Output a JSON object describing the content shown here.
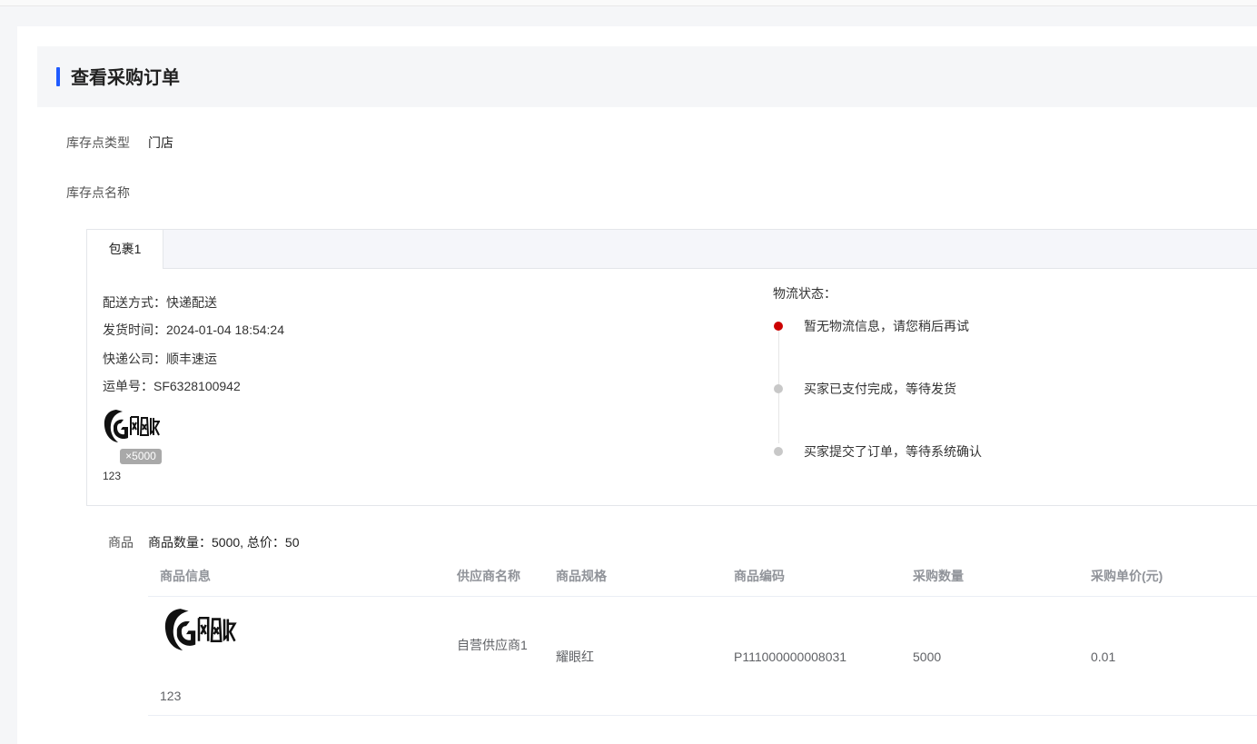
{
  "page": {
    "title": "查看采购订单"
  },
  "fields": {
    "stock_type_label": "库存点类型",
    "stock_type_value": "门店",
    "stock_name_label": "库存点名称",
    "stock_name_value": ""
  },
  "package": {
    "tab_label": "包裹1",
    "delivery_method": "配送方式：快递配送",
    "ship_time": "发货时间：2024-01-04 18:54:24",
    "courier": "快递公司：顺丰速运",
    "tracking_no": "运单号：SF6328100942",
    "product_logo_icon": "fengmianshou-logo",
    "quantity_badge": "×5000",
    "product_name": "123",
    "logistics": {
      "title": "物流状态：",
      "events": [
        {
          "text": "暂无物流信息，请您稍后再试",
          "color": "#cc0000"
        },
        {
          "text": "买家已支付完成，等待发货",
          "color": "#c8c8c8"
        },
        {
          "text": "买家提交了订单，等待系统确认",
          "color": "#c8c8c8"
        }
      ]
    }
  },
  "goods": {
    "label": "商品",
    "summary": "商品数量：5000, 总价：50",
    "columns": [
      "商品信息",
      "供应商名称",
      "商品规格",
      "商品编码",
      "采购数量",
      "采购单价(元)"
    ],
    "rows": [
      {
        "name": "123",
        "supplier": "自营供应商1",
        "spec": "耀眼红",
        "code": "P111000000008031",
        "quantity": "5000",
        "unit_price": "0.01"
      }
    ]
  }
}
